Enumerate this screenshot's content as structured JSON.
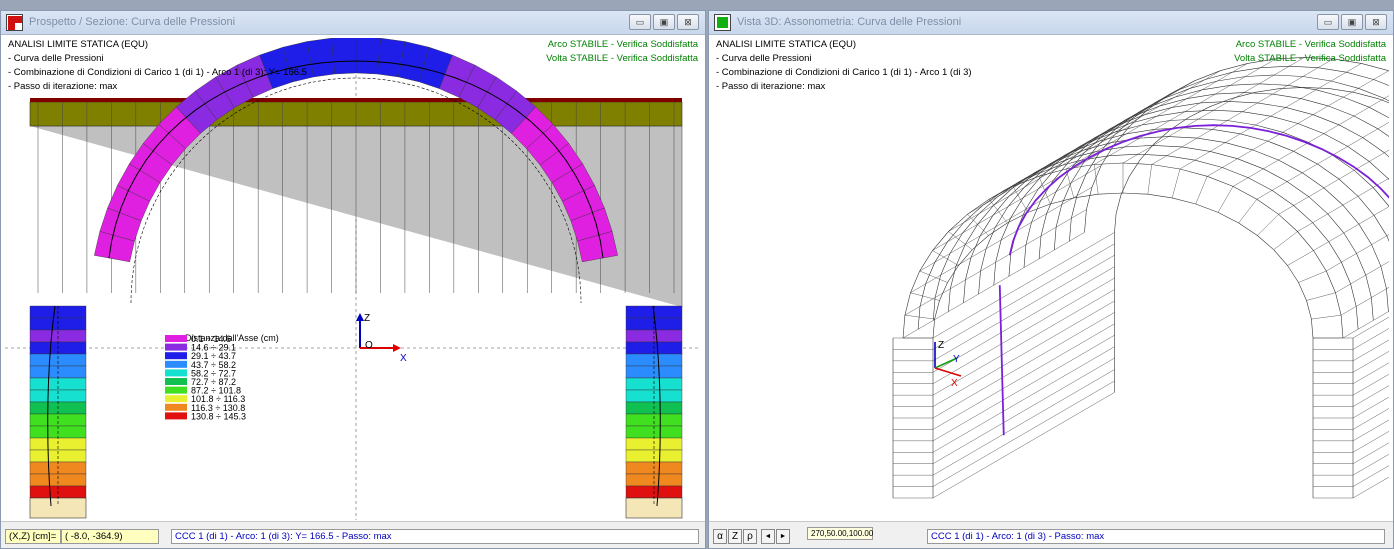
{
  "left_window": {
    "title": "Prospetto / Sezione: Curva delle Pressioni",
    "info": [
      "ANALISI LIMITE STATICA (EQU)",
      "- Curva delle Pressioni",
      "- Combinazione di Condizioni di Carico 1 (di 1) - Arco 1 (di 3): Y= 166.5",
      " - Passo di iterazione: max"
    ],
    "status": [
      "Arco STABILE - Verifica Soddisfatta",
      "Volta STABILE - Verifica Soddisfatta"
    ],
    "legend": {
      "title": "Distanza dall'Asse (cm)",
      "items": [
        {
          "label": "0.1 ÷ 14.6",
          "color": "#e020e0"
        },
        {
          "label": "14.6 ÷ 29.1",
          "color": "#8a2be2"
        },
        {
          "label": "29.1 ÷ 43.7",
          "color": "#1e1ee8"
        },
        {
          "label": "43.7 ÷ 58.2",
          "color": "#2a8cff"
        },
        {
          "label": "58.2 ÷ 72.7",
          "color": "#16e0d0"
        },
        {
          "label": "72.7 ÷ 87.2",
          "color": "#10c050"
        },
        {
          "label": "87.2 ÷ 101.8",
          "color": "#40e020"
        },
        {
          "label": "101.8 ÷ 116.3",
          "color": "#e8f030"
        },
        {
          "label": "116.3 ÷ 130.8",
          "color": "#f08820"
        },
        {
          "label": "130.8 ÷ 145.3",
          "color": "#e01010"
        }
      ]
    },
    "axes": {
      "z": "Z",
      "x": "X",
      "origin": "O"
    },
    "statusbar": {
      "coord_label": "(X,Z) [cm]=",
      "coord_value": "( -8.0, -364.9)",
      "message": "CCC 1 (di 1) - Arco: 1 (di 3): Y= 166.5 - Passo: max"
    },
    "colors": {
      "fill_soil": "#808000",
      "fill_wall": "#c0c0c0",
      "top_band": "#800000",
      "base": "#f5e6b8"
    }
  },
  "right_window": {
    "title": "Vista 3D: Assonometria: Curva delle Pressioni",
    "info": [
      "ANALISI LIMITE STATICA (EQU)",
      "- Curva delle Pressioni",
      "- Combinazione di Condizioni di Carico 1 (di 1) - Arco 1 (di 3)",
      " - Passo di iterazione: max"
    ],
    "status": [
      "Arco STABILE - Verifica Soddisfatta",
      "Volta STABILE - Verifica Soddisfatta"
    ],
    "axes": {
      "z": "Z",
      "y": "Y",
      "x": "X"
    },
    "statusbar": {
      "tool_alpha": "α",
      "tool_z": "Z",
      "tool_rho": "ρ",
      "tool_left": "◄",
      "tool_right": "►",
      "view_params": "270,50.00,100.00",
      "message": "CCC 1 (di 1) - Arco: 1 (di 3) - Passo: max"
    },
    "colors": {
      "curve": "#7a20d8",
      "wire": "#333333"
    }
  }
}
